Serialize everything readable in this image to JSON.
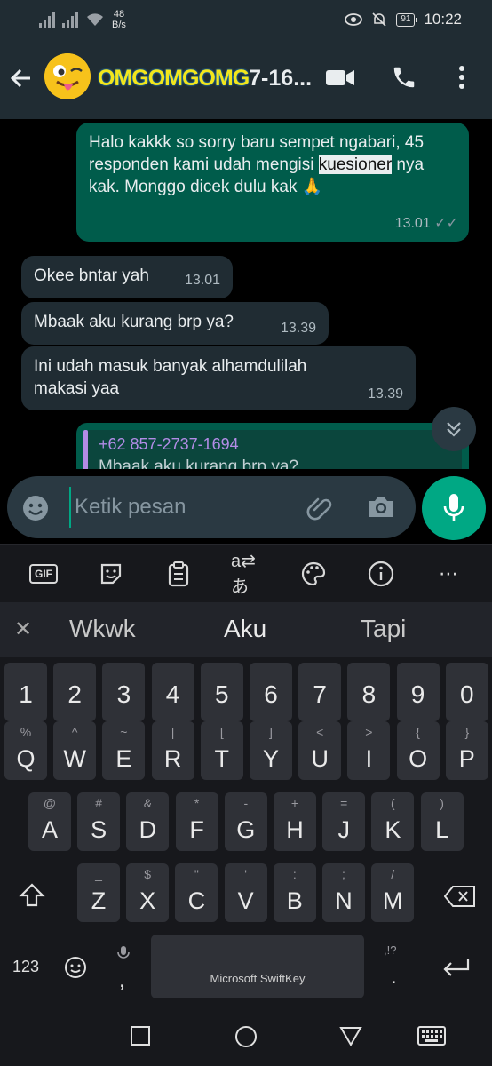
{
  "status_bar": {
    "net_speed_value": "48",
    "net_speed_unit": "B/s",
    "battery": "91",
    "time": "10:22",
    "icons": [
      "signal-icon",
      "signal-icon",
      "wifi-icon",
      "eye-icon",
      "mute-bell-icon",
      "battery-icon"
    ]
  },
  "header": {
    "contact_name_overlay": "OMGOMGOMG",
    "contact_name_suffix": "7-16...",
    "icons": [
      "back-arrow-icon",
      "avatar-emoji",
      "video-call-icon",
      "voice-call-icon",
      "more-vert-icon"
    ]
  },
  "messages": [
    {
      "dir": "out",
      "text_before": "Halo kakkk so sorry baru sempet ngabari, 45 responden kami udah mengisi ",
      "highlight": "kuesioner",
      "text_after": " nya kak. Monggo dicek dulu kak 🙏",
      "time": "13.01",
      "ticks": "✓✓"
    },
    {
      "dir": "in",
      "text": "Okee bntar yah",
      "time": "13.01"
    },
    {
      "dir": "in",
      "text": "Mbaak aku kurang brp ya?",
      "time": "13.39"
    },
    {
      "dir": "in",
      "text": "Ini udah masuk banyak alhamdulilah makasi yaa",
      "time": "13.39"
    }
  ],
  "quoted_reply": {
    "name": "+62 857-2737-1694",
    "text": "Mbaak aku kurang brp ya?"
  },
  "composer": {
    "placeholder": "Ketik pesan"
  },
  "keyboard": {
    "toolbar": [
      "GIF",
      "sticker-icon",
      "clipboard-icon",
      "translate-icon",
      "palette-icon",
      "info-icon",
      "more-horiz-icon"
    ],
    "suggestions": [
      "Wkwk",
      "Aku",
      "Tapi"
    ],
    "numbers": [
      "1",
      "2",
      "3",
      "4",
      "5",
      "6",
      "7",
      "8",
      "9",
      "0"
    ],
    "row1": [
      {
        "k": "Q",
        "s": "%"
      },
      {
        "k": "W",
        "s": "^"
      },
      {
        "k": "E",
        "s": "~"
      },
      {
        "k": "R",
        "s": "|"
      },
      {
        "k": "T",
        "s": "["
      },
      {
        "k": "Y",
        "s": "]"
      },
      {
        "k": "U",
        "s": "<"
      },
      {
        "k": "I",
        "s": ">"
      },
      {
        "k": "O",
        "s": "{"
      },
      {
        "k": "P",
        "s": "}"
      }
    ],
    "row2": [
      {
        "k": "A",
        "s": "@"
      },
      {
        "k": "S",
        "s": "#"
      },
      {
        "k": "D",
        "s": "&"
      },
      {
        "k": "F",
        "s": "*"
      },
      {
        "k": "G",
        "s": "-"
      },
      {
        "k": "H",
        "s": "+"
      },
      {
        "k": "J",
        "s": "="
      },
      {
        "k": "K",
        "s": "("
      },
      {
        "k": "L",
        "s": ")"
      }
    ],
    "row3": [
      {
        "k": "Z",
        "s": "_"
      },
      {
        "k": "X",
        "s": "$"
      },
      {
        "k": "C",
        "s": "\""
      },
      {
        "k": "V",
        "s": "'"
      },
      {
        "k": "B",
        "s": ":"
      },
      {
        "k": "N",
        "s": ";"
      },
      {
        "k": "M",
        "s": "/"
      }
    ],
    "num_toggle": "123",
    "comma": ",",
    "period": ".",
    "period_sub": ",!?",
    "space_label": "Microsoft SwiftKey"
  }
}
